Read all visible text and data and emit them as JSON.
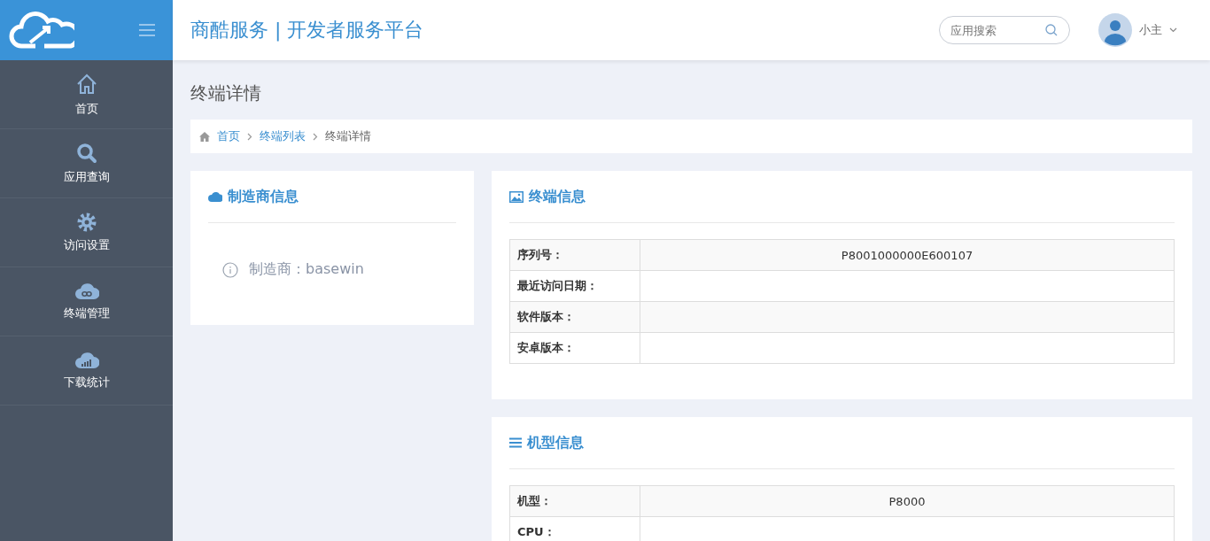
{
  "header": {
    "brand": "商酷服务 | 开发者服务平台",
    "search": {
      "placeholder": "应用搜索"
    },
    "user": {
      "name": "小主"
    }
  },
  "sidebar": {
    "items": [
      {
        "kind": "home",
        "label": "首页"
      },
      {
        "kind": "search",
        "label": "应用查询"
      },
      {
        "kind": "gear",
        "label": "访问设置"
      },
      {
        "kind": "cloud-link",
        "label": "终端管理"
      },
      {
        "kind": "cloud-chart",
        "label": "下载统计"
      }
    ]
  },
  "page_title": "终端详情",
  "breadcrumb": [
    {
      "label": "首页",
      "link": true
    },
    {
      "label": "终端列表",
      "link": true
    },
    {
      "label": "终端详情",
      "link": false
    }
  ],
  "manufacturer_card": {
    "title": "制造商信息",
    "info": "制造商：basewin"
  },
  "cards": [
    {
      "kind": "image",
      "title": "终端信息",
      "rows": [
        {
          "label": "序列号：",
          "value": "P8001000000E600107"
        },
        {
          "label": "最近访问日期："
        },
        {
          "label": "软件版本："
        },
        {
          "label": "安卓版本："
        }
      ]
    },
    {
      "kind": "list",
      "title": "机型信息",
      "rows": [
        {
          "label": "机型：",
          "value": "P8000"
        },
        {
          "label": "CPU："
        }
      ]
    }
  ]
}
